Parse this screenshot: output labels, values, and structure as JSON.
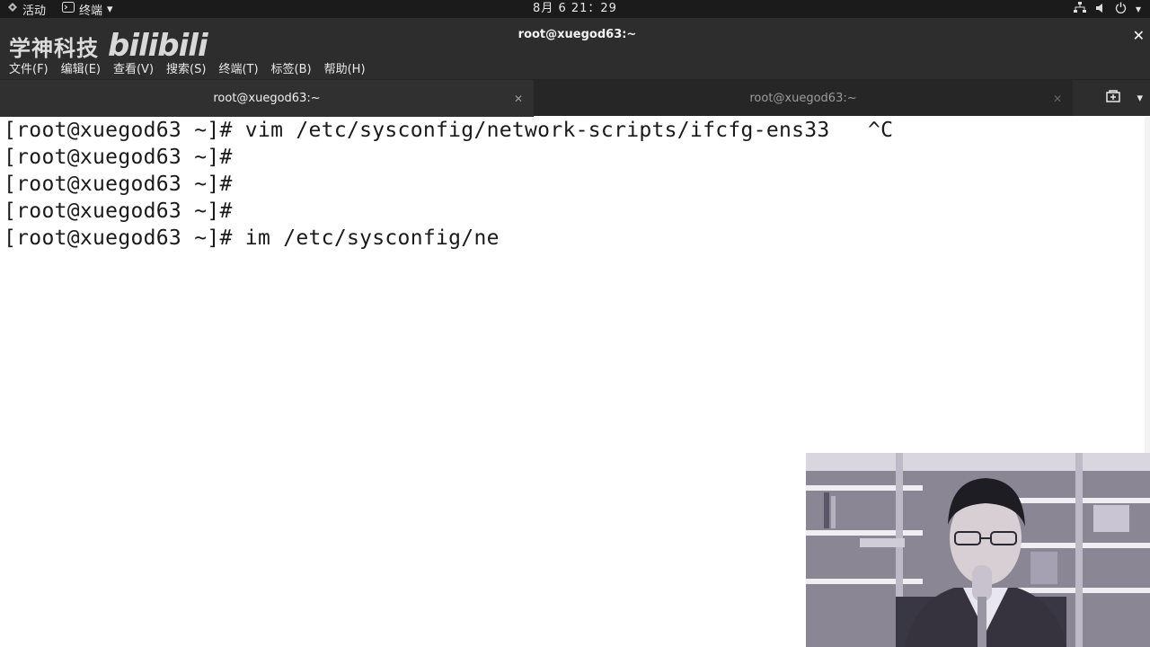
{
  "topbar": {
    "activities": "活动",
    "app_menu": "终端",
    "clock": "8月 6  21：29",
    "icons": [
      "network-icon",
      "volume-icon",
      "power-icon"
    ]
  },
  "window": {
    "title": "root@xuegod63:~",
    "watermark_cn": "学神科技",
    "watermark_bili": "bilibili",
    "menu": [
      "文件(F)",
      "编辑(E)",
      "查看(V)",
      "搜索(S)",
      "终端(T)",
      "标签(B)",
      "帮助(H)"
    ]
  },
  "tabs": [
    {
      "label": "root@xuegod63:~",
      "active": true
    },
    {
      "label": "root@xuegod63:~",
      "active": false
    }
  ],
  "terminal": {
    "lines": [
      "[root@xuegod63 ~]# vim /etc/sysconfig/network-scripts/ifcfg-ens33   ^C",
      "[root@xuegod63 ~]#",
      "[root@xuegod63 ~]#",
      "[root@xuegod63 ~]#",
      "[root@xuegod63 ~]# im /etc/sysconfig/ne"
    ]
  },
  "colors": {
    "topbar_bg": "#1b1b1b",
    "header_bg": "#2d2d2d",
    "terminal_bg": "#ffffff",
    "terminal_fg": "#1a1a1a"
  }
}
